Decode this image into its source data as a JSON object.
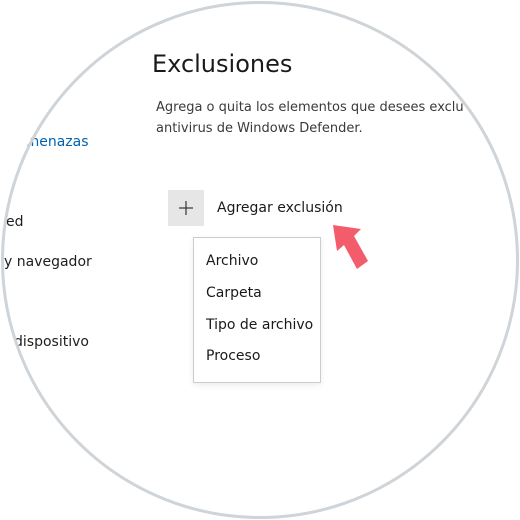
{
  "section": {
    "title": "Exclusiones",
    "description": "Agrega o quita los elementos que desees exclu\nantivirus de Windows Defender."
  },
  "sidebar": {
    "items": [
      {
        "label": "amenazas",
        "active": true
      },
      {
        "label": "ed",
        "active": false
      },
      {
        "label": "y navegador",
        "active": false
      },
      {
        "label": "dispositivo",
        "active": false
      }
    ]
  },
  "add_button": {
    "icon": "plus-icon",
    "label": "Agregar exclusión"
  },
  "dropdown": {
    "items": [
      "Archivo",
      "Carpeta",
      "Tipo de archivo",
      "Proceso"
    ]
  },
  "colors": {
    "accent": "#0063b1",
    "annotation_arrow": "#f25c6b"
  }
}
